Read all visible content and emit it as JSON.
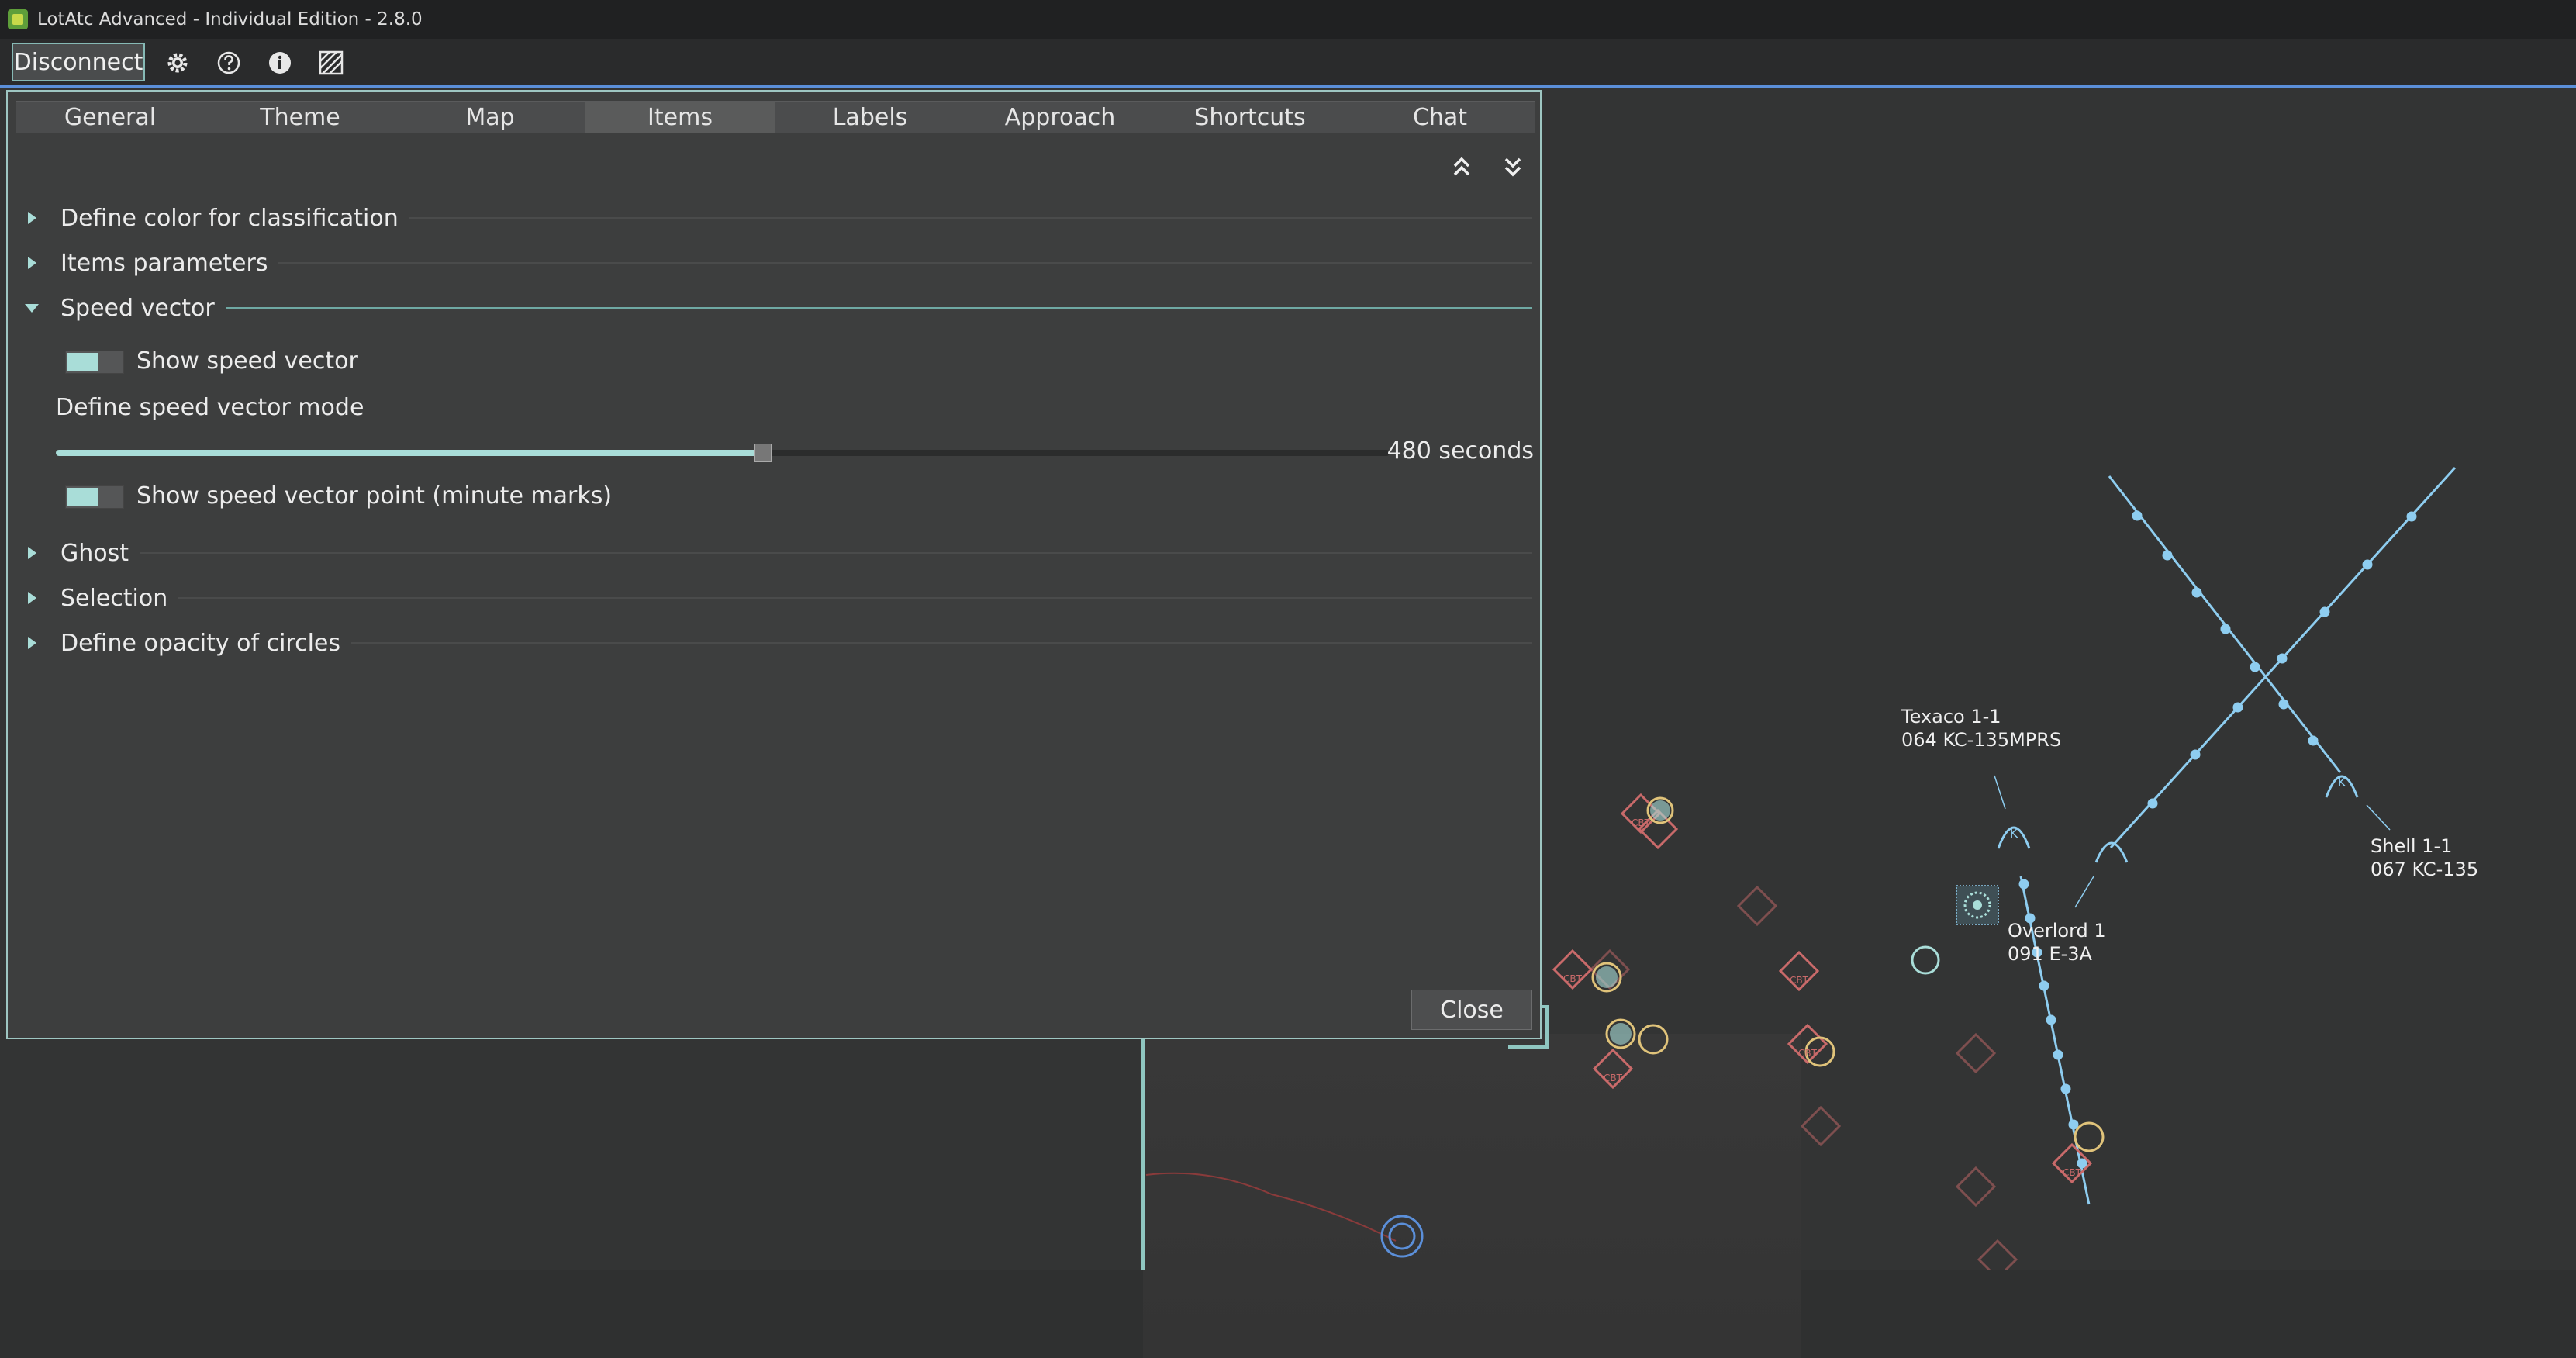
{
  "window": {
    "title": "LotAtc Advanced - Individual Edition - 2.8.0"
  },
  "toolbar": {
    "disconnect_label": "Disconnect",
    "icons": [
      "gear-icon",
      "help-icon",
      "info-icon",
      "layers-icon"
    ]
  },
  "dialog": {
    "tabs": [
      {
        "label": "General"
      },
      {
        "label": "Theme"
      },
      {
        "label": "Map"
      },
      {
        "label": "Items",
        "active": true
      },
      {
        "label": "Labels"
      },
      {
        "label": "Approach"
      },
      {
        "label": "Shortcuts"
      },
      {
        "label": "Chat"
      }
    ],
    "sections": {
      "color_classification": "Define color for classification",
      "items_parameters": "Items parameters",
      "speed_vector": "Speed vector",
      "ghost": "Ghost",
      "selection": "Selection",
      "opacity_circles": "Define opacity of circles"
    },
    "speed_vector": {
      "show_speed_vector": "Show speed vector",
      "show_speed_vector_on": true,
      "mode_label": "Define speed vector mode",
      "slider_value": "480 seconds",
      "slider_fraction": 0.53,
      "show_points": "Show speed vector point (minute marks)",
      "show_points_on": true
    },
    "close_label": "Close"
  },
  "map": {
    "labels": {
      "texaco_name": "Texaco 1-1",
      "texaco_type": "064 KC-135MPRS",
      "overlord_name": "Overlord 1",
      "overlord_type": "091 E-3A",
      "shell_name": "Shell 1-1",
      "shell_type": "067 KC-135"
    },
    "contact_tag": "CBT",
    "colors": {
      "track": "#8ecdf0",
      "hostile": "#c96a6a",
      "friendly_halo": "#a9ddd8",
      "accent": "#5b8fd9"
    }
  }
}
